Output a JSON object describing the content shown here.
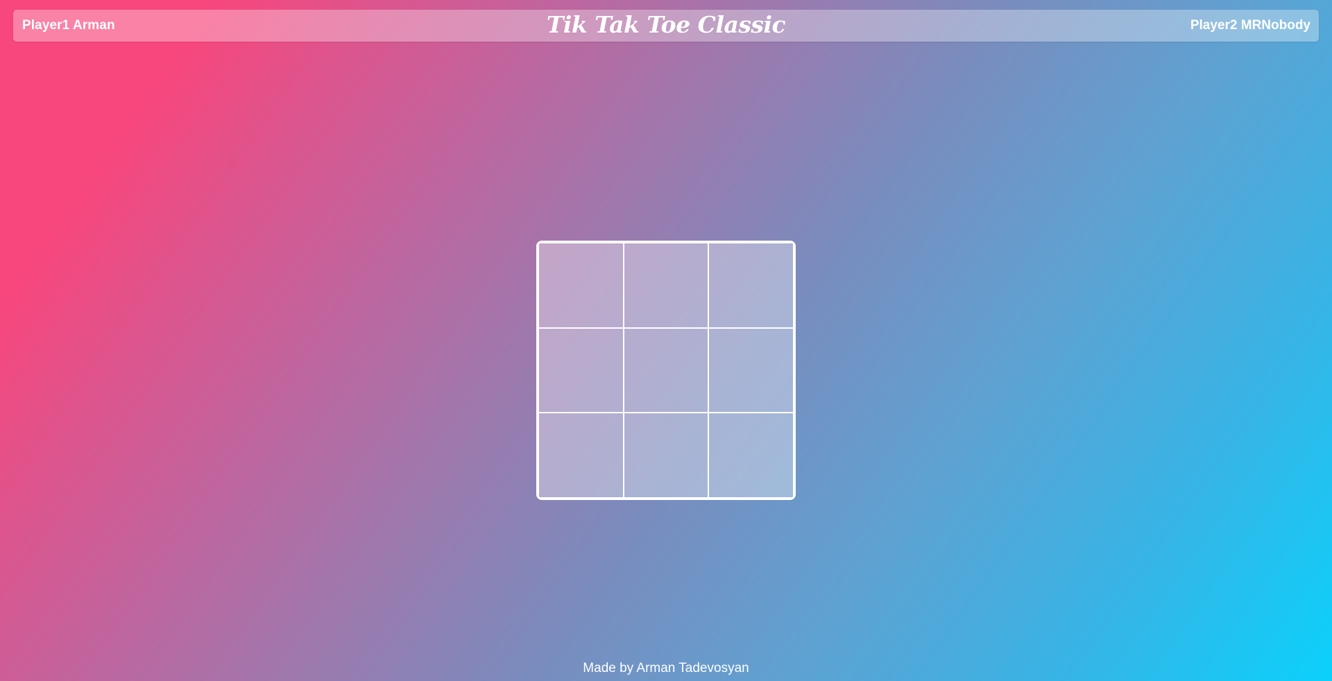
{
  "header": {
    "player1_label": "Player1 Arman",
    "title": "Tik Tak Toe Classic",
    "player2_label": "Player2 MRNobody"
  },
  "board": {
    "cells": [
      "",
      "",
      "",
      "",
      "",
      "",
      "",
      "",
      ""
    ]
  },
  "footer": {
    "credit": "Made by Arman Tadevosyan"
  },
  "colors": {
    "gradient_start": "#f7477d",
    "gradient_mid": "#7b8bbd",
    "gradient_end": "#0bd1fb",
    "board_line": "#ffffff"
  }
}
